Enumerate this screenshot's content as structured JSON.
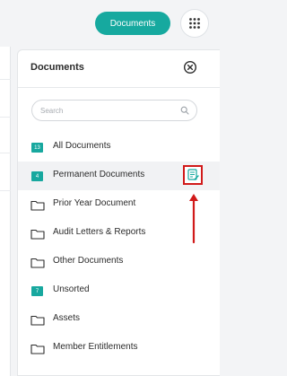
{
  "header": {
    "documents_button": "Documents",
    "apps_icon": "grid-dots-icon"
  },
  "panel": {
    "title": "Documents",
    "close_icon": "close-circle-icon",
    "search": {
      "placeholder": "Search",
      "value": ""
    },
    "items": [
      {
        "label": "All Documents",
        "badge": "13",
        "icon": "folder-badge-icon"
      },
      {
        "label": "Permanent Documents",
        "badge": "4",
        "icon": "folder-badge-icon",
        "selected": true,
        "action_icon": "edit-document-icon"
      },
      {
        "label": "Prior Year Document",
        "icon": "folder-icon"
      },
      {
        "label": "Audit Letters & Reports",
        "icon": "folder-icon"
      },
      {
        "label": "Other Documents",
        "icon": "folder-icon"
      },
      {
        "label": "Unsorted",
        "badge": "7",
        "icon": "folder-badge-icon"
      },
      {
        "label": "Assets",
        "icon": "folder-icon"
      },
      {
        "label": "Member Entitlements",
        "icon": "folder-icon"
      }
    ]
  },
  "colors": {
    "accent": "#16a99f",
    "highlight": "#d11a1a",
    "selected_bg": "#f1f2f4"
  }
}
